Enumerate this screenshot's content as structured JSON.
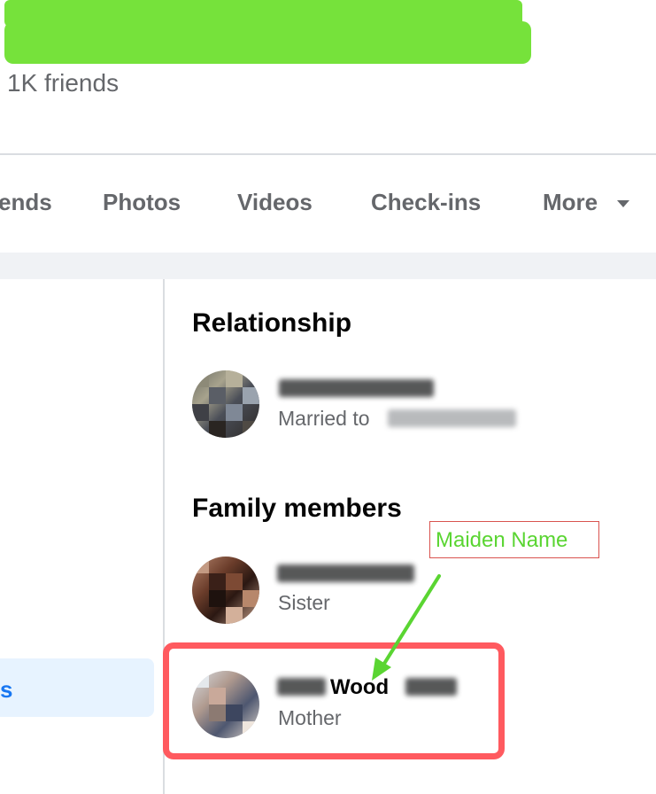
{
  "profile": {
    "friends_count": "1K friends",
    "name_redaction_color": "#76e23b"
  },
  "tabs": [
    {
      "label": "ends"
    },
    {
      "label": "Photos"
    },
    {
      "label": "Videos"
    },
    {
      "label": "Check-ins"
    },
    {
      "label": "More"
    }
  ],
  "sidebar": {
    "active_item_label": "s"
  },
  "relationship": {
    "title": "Relationship",
    "status_prefix": "Married to"
  },
  "family": {
    "title": "Family members",
    "members": [
      {
        "relation": "Sister"
      },
      {
        "name_visible": "Wood",
        "relation": "Mother"
      }
    ]
  },
  "annotation": {
    "label": "Maiden Name",
    "label_color": "#5ad532",
    "highlight_color": "#ff5a5f"
  },
  "icons": {
    "more_caret": "caret-down-icon"
  }
}
